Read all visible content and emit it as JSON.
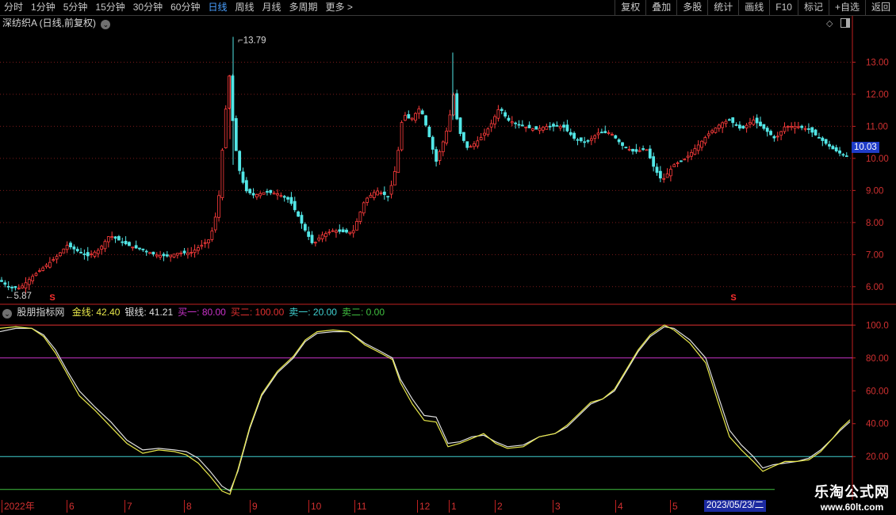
{
  "toolbar": {
    "periods": [
      "分时",
      "1分钟",
      "5分钟",
      "15分钟",
      "30分钟",
      "60分钟",
      "日线",
      "周线",
      "月线",
      "多周期",
      "更多 >"
    ],
    "active_period": "日线",
    "tools": [
      "复权",
      "叠加",
      "多股",
      "统计",
      "画线",
      "F10",
      "标记",
      "+自选",
      "返回"
    ]
  },
  "main_chart": {
    "title": "深纺织A (日线,前复权)",
    "current_price": "10.03",
    "high_marker": "13.79",
    "low_marker": "5.87",
    "signal_marks": [
      "S",
      "S"
    ]
  },
  "indicator": {
    "name": "股朋指标网",
    "legend": [
      {
        "label": "金线:",
        "value": "42.40",
        "color": "#e8e84a"
      },
      {
        "label": "银线:",
        "value": "41.21",
        "color": "#e0e0e0"
      },
      {
        "label": "买一:",
        "value": "80.00",
        "color": "#c832c8"
      },
      {
        "label": "买二:",
        "value": "100.00",
        "color": "#e03030"
      },
      {
        "label": "卖一:",
        "value": "20.00",
        "color": "#40d0d0"
      },
      {
        "label": "卖二:",
        "value": "0.00",
        "color": "#40c040"
      }
    ]
  },
  "chart_data": [
    {
      "type": "candlestick",
      "title": "深纺织A (日线,前复权)",
      "y_ticks": [
        "13.00",
        "12.00",
        "11.00",
        "10.00",
        "9.00",
        "8.00",
        "7.00",
        "6.00"
      ],
      "ylim": [
        5.6,
        14.0
      ],
      "x_ticks": [
        "2022年",
        "6",
        "7",
        "8",
        "9",
        "10",
        "11",
        "12",
        "1",
        "2",
        "3",
        "4",
        "5"
      ],
      "grid": true,
      "close_path": [
        [
          0,
          6.2
        ],
        [
          10,
          6.0
        ],
        [
          25,
          5.95
        ],
        [
          40,
          6.3
        ],
        [
          55,
          6.6
        ],
        [
          70,
          6.9
        ],
        [
          85,
          7.3
        ],
        [
          95,
          7.15
        ],
        [
          110,
          6.95
        ],
        [
          125,
          7.15
        ],
        [
          138,
          7.6
        ],
        [
          150,
          7.45
        ],
        [
          165,
          7.25
        ],
        [
          180,
          7.15
        ],
        [
          195,
          7.0
        ],
        [
          210,
          6.95
        ],
        [
          225,
          7.05
        ],
        [
          240,
          7.05
        ],
        [
          255,
          7.3
        ],
        [
          265,
          7.5
        ],
        [
          275,
          8.5
        ],
        [
          283,
          11.1
        ],
        [
          289,
          12.6
        ],
        [
          294,
          11.0
        ],
        [
          298,
          10.2
        ],
        [
          303,
          9.5
        ],
        [
          310,
          9.0
        ],
        [
          320,
          8.85
        ],
        [
          335,
          8.95
        ],
        [
          350,
          8.9
        ],
        [
          365,
          8.7
        ],
        [
          375,
          8.25
        ],
        [
          385,
          7.75
        ],
        [
          395,
          7.3
        ],
        [
          405,
          7.6
        ],
        [
          420,
          7.75
        ],
        [
          435,
          7.7
        ],
        [
          445,
          7.7
        ],
        [
          460,
          8.7
        ],
        [
          475,
          9.0
        ],
        [
          490,
          8.8
        ],
        [
          500,
          9.8
        ],
        [
          508,
          11.4
        ],
        [
          518,
          11.2
        ],
        [
          530,
          11.6
        ],
        [
          540,
          10.8
        ],
        [
          550,
          9.9
        ],
        [
          560,
          10.6
        ],
        [
          565,
          11.0
        ],
        [
          572,
          12.0
        ],
        [
          578,
          10.9
        ],
        [
          590,
          10.3
        ],
        [
          605,
          10.6
        ],
        [
          618,
          11.0
        ],
        [
          630,
          11.6
        ],
        [
          640,
          11.2
        ],
        [
          660,
          11.0
        ],
        [
          675,
          10.9
        ],
        [
          690,
          11.0
        ],
        [
          710,
          11.0
        ],
        [
          725,
          10.6
        ],
        [
          740,
          10.5
        ],
        [
          755,
          10.8
        ],
        [
          770,
          10.8
        ],
        [
          785,
          10.4
        ],
        [
          800,
          10.2
        ],
        [
          815,
          10.3
        ],
        [
          825,
          9.7
        ],
        [
          835,
          9.3
        ],
        [
          850,
          9.8
        ],
        [
          865,
          10.0
        ],
        [
          880,
          10.4
        ],
        [
          895,
          10.8
        ],
        [
          910,
          11.1
        ],
        [
          920,
          11.2
        ],
        [
          935,
          10.9
        ],
        [
          950,
          11.2
        ],
        [
          965,
          10.9
        ],
        [
          978,
          10.6
        ],
        [
          990,
          11.0
        ],
        [
          1005,
          11.0
        ],
        [
          1020,
          10.9
        ],
        [
          1035,
          10.6
        ],
        [
          1050,
          10.3
        ],
        [
          1060,
          10.15
        ],
        [
          1072,
          10.03
        ]
      ]
    },
    {
      "type": "line",
      "title": "股朋指标网",
      "y_ticks": [
        "100.0",
        "80.00",
        "60.00",
        "40.00",
        "20.00"
      ],
      "ylim": [
        -4,
        104
      ],
      "horizontal_lines": [
        {
          "name": "买一",
          "value": 80,
          "color": "#c832c8"
        },
        {
          "name": "买二",
          "value": 100,
          "color": "#e03030"
        },
        {
          "name": "卖一",
          "value": 20,
          "color": "#40d0d0"
        },
        {
          "name": "卖二",
          "value": 0,
          "color": "#40c040"
        }
      ],
      "series": [
        {
          "name": "金线",
          "color": "#e8e84a",
          "points": [
            [
              0,
              98
            ],
            [
              20,
              99
            ],
            [
              40,
              98
            ],
            [
              55,
              93
            ],
            [
              70,
              83
            ],
            [
              85,
              70
            ],
            [
              100,
              57
            ],
            [
              120,
              48
            ],
            [
              140,
              38
            ],
            [
              160,
              28
            ],
            [
              180,
              22
            ],
            [
              200,
              24
            ],
            [
              220,
              23
            ],
            [
              235,
              21
            ],
            [
              250,
              16
            ],
            [
              265,
              8
            ],
            [
              280,
              -1
            ],
            [
              290,
              -3
            ],
            [
              300,
              12
            ],
            [
              315,
              38
            ],
            [
              330,
              58
            ],
            [
              350,
              72
            ],
            [
              370,
              81
            ],
            [
              385,
              91
            ],
            [
              400,
              96
            ],
            [
              420,
              97
            ],
            [
              440,
              96
            ],
            [
              460,
              88
            ],
            [
              480,
              83
            ],
            [
              495,
              79
            ],
            [
              505,
              65
            ],
            [
              520,
              52
            ],
            [
              535,
              42
            ],
            [
              550,
              41
            ],
            [
              565,
              26
            ],
            [
              580,
              28
            ],
            [
              595,
              31
            ],
            [
              610,
              34
            ],
            [
              625,
              28
            ],
            [
              640,
              25
            ],
            [
              660,
              26
            ],
            [
              680,
              32
            ],
            [
              700,
              34
            ],
            [
              715,
              39
            ],
            [
              730,
              46
            ],
            [
              745,
              53
            ],
            [
              760,
              55
            ],
            [
              775,
              61
            ],
            [
              790,
              73
            ],
            [
              805,
              85
            ],
            [
              820,
              94
            ],
            [
              838,
              100
            ],
            [
              850,
              97
            ],
            [
              870,
              89
            ],
            [
              890,
              77
            ],
            [
              905,
              54
            ],
            [
              920,
              32
            ],
            [
              935,
              24
            ],
            [
              950,
              17
            ],
            [
              962,
              11
            ],
            [
              975,
              14
            ],
            [
              990,
              17
            ],
            [
              1005,
              17
            ],
            [
              1020,
              18
            ],
            [
              1035,
              23
            ],
            [
              1050,
              31
            ],
            [
              1060,
              37
            ],
            [
              1072,
              42.4
            ]
          ]
        },
        {
          "name": "银线",
          "color": "#e0e0e0",
          "points": [
            [
              0,
              96
            ],
            [
              20,
              98
            ],
            [
              40,
              98
            ],
            [
              55,
              94
            ],
            [
              70,
              85
            ],
            [
              85,
              72
            ],
            [
              100,
              60
            ],
            [
              120,
              50
            ],
            [
              140,
              41
            ],
            [
              160,
              30
            ],
            [
              180,
              24
            ],
            [
              200,
              25
            ],
            [
              220,
              24
            ],
            [
              235,
              23
            ],
            [
              250,
              19
            ],
            [
              265,
              11
            ],
            [
              280,
              2
            ],
            [
              290,
              -1
            ],
            [
              300,
              11
            ],
            [
              315,
              37
            ],
            [
              330,
              57
            ],
            [
              350,
              71
            ],
            [
              370,
              80
            ],
            [
              385,
              90
            ],
            [
              400,
              95
            ],
            [
              420,
              96
            ],
            [
              440,
              96
            ],
            [
              460,
              89
            ],
            [
              480,
              84
            ],
            [
              495,
              80
            ],
            [
              505,
              67
            ],
            [
              520,
              55
            ],
            [
              535,
              45
            ],
            [
              550,
              44
            ],
            [
              565,
              28
            ],
            [
              580,
              29
            ],
            [
              595,
              32
            ],
            [
              610,
              33
            ],
            [
              625,
              29
            ],
            [
              640,
              26
            ],
            [
              660,
              27
            ],
            [
              680,
              32
            ],
            [
              700,
              34
            ],
            [
              715,
              38
            ],
            [
              730,
              45
            ],
            [
              745,
              52
            ],
            [
              760,
              55
            ],
            [
              775,
              60
            ],
            [
              790,
              72
            ],
            [
              805,
              84
            ],
            [
              820,
              93
            ],
            [
              838,
              99
            ],
            [
              850,
              98
            ],
            [
              870,
              91
            ],
            [
              890,
              80
            ],
            [
              905,
              58
            ],
            [
              920,
              36
            ],
            [
              935,
              27
            ],
            [
              950,
              20
            ],
            [
              962,
              13
            ],
            [
              975,
              15
            ],
            [
              990,
              16
            ],
            [
              1005,
              17
            ],
            [
              1020,
              19
            ],
            [
              1035,
              24
            ],
            [
              1050,
              31
            ],
            [
              1060,
              36
            ],
            [
              1072,
              41.21
            ]
          ]
        }
      ]
    }
  ],
  "date_bar": {
    "labels": [
      "2022年",
      "6",
      "7",
      "8",
      "9",
      "10",
      "11",
      "12",
      "1",
      "2",
      "3",
      "4",
      "5"
    ],
    "cursor_date": "2023/05/23/二"
  },
  "watermark": {
    "line1": "乐淘公式网",
    "line2": "www.60lt.com"
  }
}
